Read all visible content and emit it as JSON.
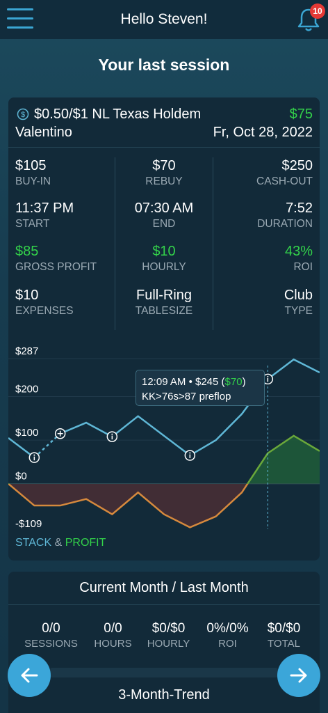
{
  "header": {
    "title": "Hello Steven!",
    "notification_count": "10"
  },
  "section_title": "Your last session",
  "session": {
    "game": "$0.50/$1 NL Texas Holdem",
    "profit": "$75",
    "location": "Valentino",
    "date": "Fr, Oct 28, 2022",
    "stats": {
      "buyin": {
        "value": "$105",
        "label": "BUY-IN"
      },
      "rebuy": {
        "value": "$70",
        "label": "REBUY"
      },
      "cashout": {
        "value": "$250",
        "label": "CASH-OUT"
      },
      "start": {
        "value": "11:37 PM",
        "label": "START"
      },
      "end": {
        "value": "07:30 AM",
        "label": "END"
      },
      "duration": {
        "value": "7:52",
        "label": "DURATION"
      },
      "gross_profit": {
        "value": "$85",
        "label": "GROSS PROFIT"
      },
      "hourly": {
        "value": "$10",
        "label": "HOURLY"
      },
      "roi": {
        "value": "43%",
        "label": "ROI"
      },
      "expenses": {
        "value": "$10",
        "label": "EXPENSES"
      },
      "tablesize": {
        "value": "Full-Ring",
        "label": "TABLESIZE"
      },
      "type": {
        "value": "Club",
        "label": "TYPE"
      }
    }
  },
  "chart_data": {
    "type": "line",
    "y_tick_labels": [
      "$287",
      "$200",
      "$100",
      "$0",
      "-$109"
    ],
    "ylim": [
      -109,
      287
    ],
    "series": [
      {
        "name": "STACK",
        "values": [
          105,
          60,
          115,
          140,
          108,
          155,
          110,
          65,
          100,
          160,
          240,
          285,
          255
        ]
      },
      {
        "name": "PROFIT",
        "values": [
          0,
          -50,
          -50,
          -35,
          -70,
          -20,
          -70,
          -100,
          -75,
          -20,
          70,
          110,
          75
        ]
      }
    ],
    "legend_separator": "&",
    "tooltip": {
      "time": "12:09 AM",
      "separator": "•",
      "stack": "$245",
      "profit": "$70",
      "hand": "KK>76s>87 preflop"
    },
    "colors": {
      "stack": "#5fb7d6",
      "profit": "#33d24a",
      "profit_negative": "#d6893d"
    }
  },
  "monthly": {
    "title": "Current Month / Last Month",
    "stats": [
      {
        "value": "0/0",
        "label": "SESSIONS"
      },
      {
        "value": "0/0",
        "label": "HOURS"
      },
      {
        "value": "$0/$0",
        "label": "HOURLY"
      },
      {
        "value": "0%/0%",
        "label": "ROI"
      },
      {
        "value": "$0/$0",
        "label": "TOTAL"
      }
    ],
    "trend_title": "3-Month-Trend"
  }
}
